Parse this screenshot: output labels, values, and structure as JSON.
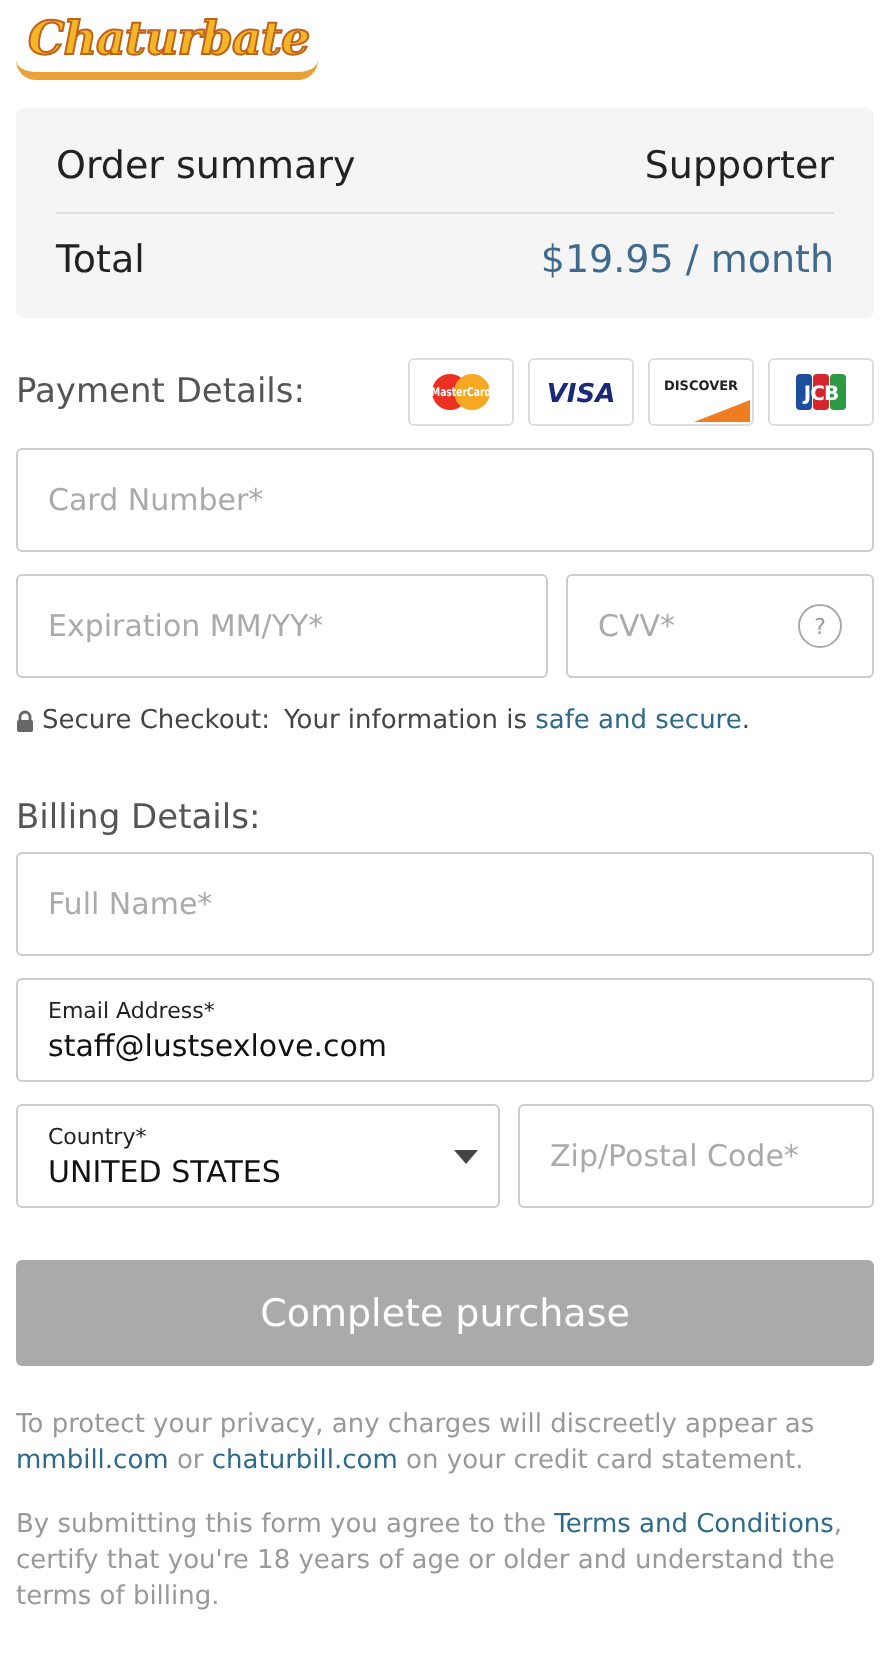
{
  "logo": {
    "text": "Chaturbate"
  },
  "order_summary": {
    "title": "Order summary",
    "plan": "Supporter",
    "total_label": "Total",
    "total_value": "$19.95 / month"
  },
  "payment": {
    "heading": "Payment Details:",
    "cards": [
      {
        "kind": "mastercard",
        "label": "MasterCard"
      },
      {
        "kind": "visa",
        "label": "VISA"
      },
      {
        "kind": "discover",
        "label": "DISCOVER"
      },
      {
        "kind": "jcb",
        "label": "JCB"
      }
    ],
    "card_number": {
      "placeholder": "Card Number*"
    },
    "expiration": {
      "placeholder": "Expiration MM/YY*"
    },
    "cvv": {
      "placeholder": "CVV*",
      "help": "?"
    },
    "secure_note": {
      "label": "Secure Checkout:",
      "segments": [
        {
          "kind": "text",
          "text": "Your information is "
        },
        {
          "kind": "link",
          "text": "safe and secure"
        },
        {
          "kind": "text",
          "text": "."
        }
      ]
    }
  },
  "billing": {
    "heading": "Billing Details:",
    "full_name": {
      "placeholder": "Full Name*"
    },
    "email": {
      "label": "Email Address*",
      "value": "staff@lustsexlove.com"
    },
    "country": {
      "label": "Country*",
      "value": "UNITED STATES"
    },
    "zip": {
      "placeholder": "Zip/Postal Code*"
    }
  },
  "submit": {
    "label": "Complete purchase",
    "disabled": true
  },
  "notes": [
    [
      {
        "kind": "text",
        "text": "To protect your privacy, any charges will discreetly appear as "
      },
      {
        "kind": "link",
        "text": "mmbill.com"
      },
      {
        "kind": "text",
        "text": " or "
      },
      {
        "kind": "link",
        "text": "chaturbill.com"
      },
      {
        "kind": "text",
        "text": " on your credit card statement."
      }
    ],
    [
      {
        "kind": "text",
        "text": "By submitting this form you agree to the "
      },
      {
        "kind": "link",
        "text": "Terms and Conditions"
      },
      {
        "kind": "text",
        "text": ", certify that you're 18 years of age or older and understand the terms of billing."
      }
    ]
  ]
}
